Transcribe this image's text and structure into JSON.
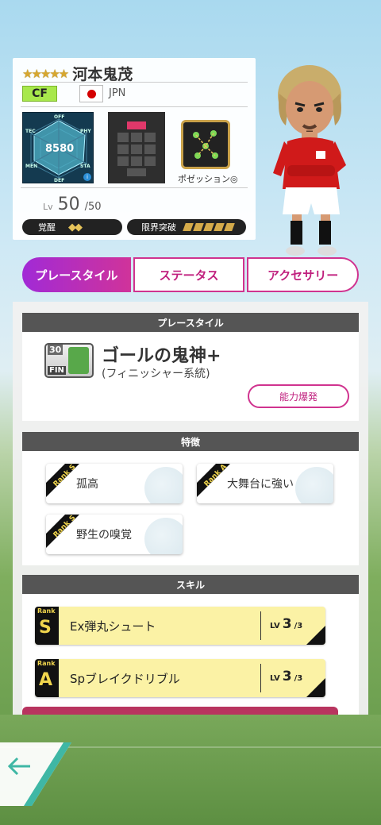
{
  "player": {
    "stars": "★★★★★",
    "name": "河本鬼茂",
    "position": "CF",
    "country": "JPN",
    "overall": "8580",
    "radar_labels": {
      "off": "OFF",
      "phy": "PHY",
      "sta": "STA",
      "def": "DEF",
      "men": "MEN",
      "tec": "TEC"
    },
    "positioning_label": "ポゼッション◎",
    "level_label": "Lv",
    "level": "50",
    "level_max": "/50",
    "awakening_label": "覚醒",
    "awakening_diamonds": "◆◆",
    "limit_break_label": "限界突破",
    "limit_break_count": 5
  },
  "tabs": [
    "プレースタイル",
    "ステータス",
    "アクセサリー"
  ],
  "playstyle": {
    "header": "プレースタイル",
    "icon_number": "30",
    "icon_label": "FIN",
    "name": "ゴールの鬼神+",
    "subtitle": "(フィニッシャー系統)",
    "ability_button": "能力爆発"
  },
  "traits": {
    "header": "特徴",
    "items": [
      {
        "rank": "S",
        "rank_label": "Rank",
        "label": "孤高"
      },
      {
        "rank": "A",
        "rank_label": "Rank",
        "label": "大舞台に強い"
      },
      {
        "rank": "S",
        "rank_label": "Rank",
        "label": "野生の嗅覚"
      }
    ]
  },
  "skills": {
    "header": "スキル",
    "items": [
      {
        "rank_label": "Rank",
        "rank": "S",
        "name": "Ex弾丸シュート",
        "lv_label": "LV",
        "lv": "3",
        "lv_max": "/3"
      },
      {
        "rank_label": "Rank",
        "rank": "A",
        "name": "Spブレイクドリブル",
        "lv_label": "LV",
        "lv": "3",
        "lv_max": "/3"
      }
    ]
  },
  "colors": {
    "accent": "#d0338f",
    "position_badge": "#a8e84c",
    "skill_bg": "#fbf2a5",
    "header_bg": "#555555"
  },
  "icons": {
    "back": "arrow-left-icon"
  }
}
